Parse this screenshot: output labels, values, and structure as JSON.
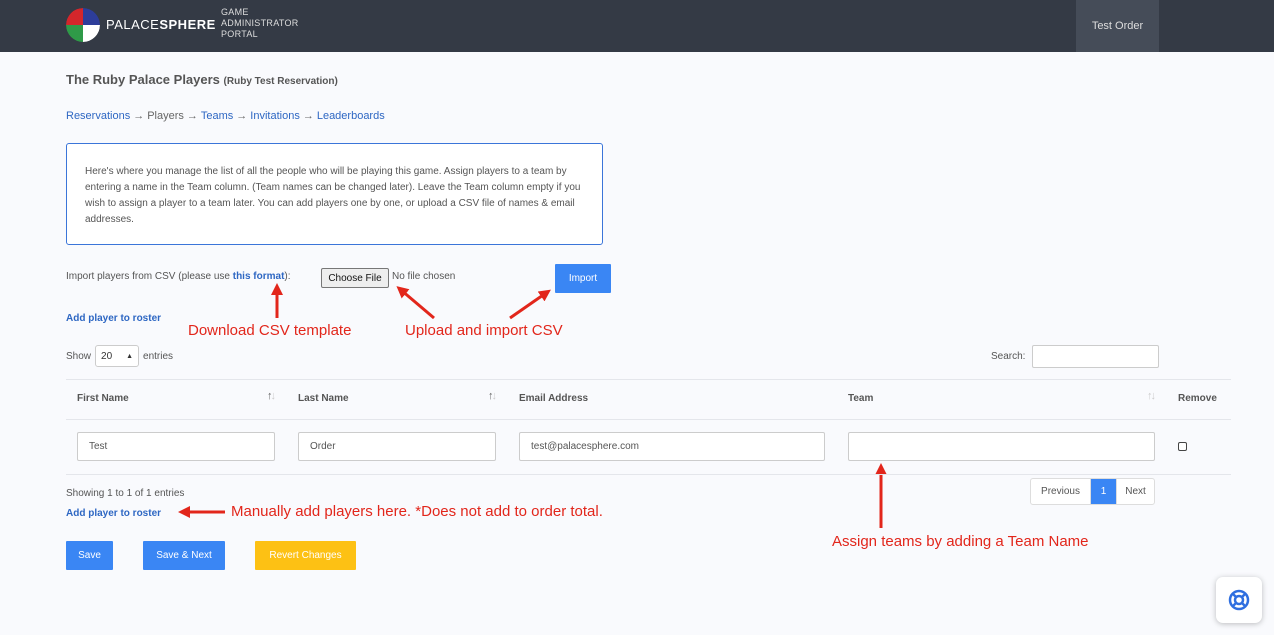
{
  "header": {
    "logo_light": "PALACE",
    "logo_bold": "SPHERE",
    "portal_lines": [
      "GAME",
      "ADMINISTRATOR",
      "PORTAL"
    ],
    "order_label": "Test Order"
  },
  "page": {
    "title": "The Ruby Palace Players",
    "subtitle": "(Ruby Test Reservation)"
  },
  "breadcrumb": {
    "items": [
      "Reservations",
      "Players",
      "Teams",
      "Invitations",
      "Leaderboards"
    ],
    "separator": "→"
  },
  "info_text": "Here's where you manage the list of all the people who will be playing this game. Assign players to a team by entering a name in the Team column. (Team names can be changed later). Leave the Team column empty if you wish to assign a player to a team later. You can add players one by one, or upload a CSV file of names & email addresses.",
  "import": {
    "label_before": "Import players from CSV (please use ",
    "link": "this format",
    "label_after": "):",
    "choose_file": "Choose File",
    "no_file": "No file chosen",
    "import_button": "Import"
  },
  "add_player_label": "Add player to roster",
  "annotations": {
    "csv_template": "Download CSV template",
    "upload": "Upload and import CSV",
    "manual": "Manually add players here. *Does not add to order total.",
    "teams": "Assign teams by adding a Team Name"
  },
  "table_controls": {
    "show": "Show",
    "entries_value": "20",
    "entries": "entries",
    "search": "Search:"
  },
  "table": {
    "columns": [
      "First Name",
      "Last Name",
      "Email Address",
      "Team",
      "Remove"
    ],
    "rows": [
      {
        "first_name": "Test",
        "last_name": "Order",
        "email": "test@palacesphere.com",
        "team": "",
        "remove": false
      }
    ]
  },
  "footer": {
    "showing": "Showing 1 to 1 of 1 entries",
    "prev": "Previous",
    "page": "1",
    "next": "Next"
  },
  "buttons": {
    "save": "Save",
    "save_next": "Save & Next",
    "revert": "Revert Changes"
  },
  "colors": {
    "topbar": "#343a45",
    "primary": "#3a86f4",
    "warning": "#fdc114",
    "annotation": "#e2261b",
    "link": "#2e67c3"
  }
}
